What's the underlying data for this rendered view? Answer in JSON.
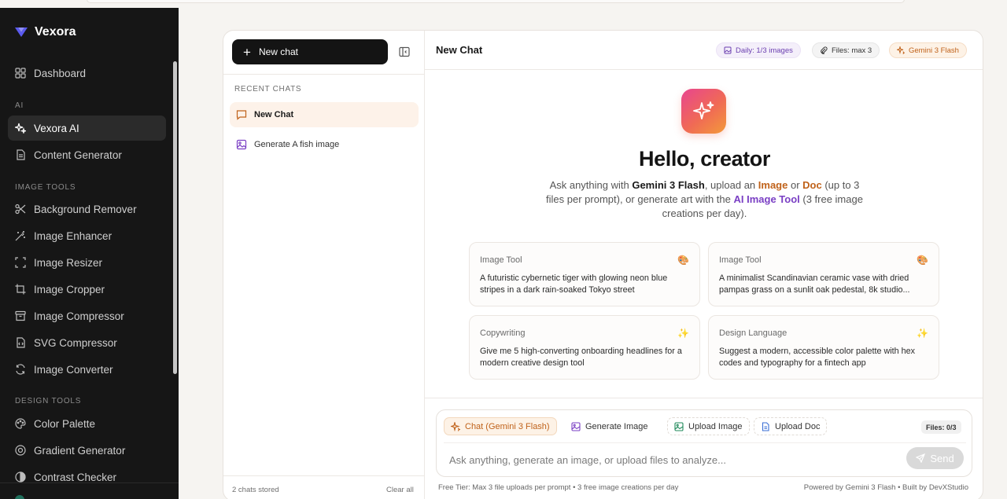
{
  "sidebar": {
    "brand": "Vexora",
    "items": [
      {
        "label": "Dashboard",
        "icon": "grid-icon"
      },
      {
        "label": "Vexora AI",
        "icon": "sparkles-icon"
      },
      {
        "label": "Content Generator",
        "icon": "document-icon"
      },
      {
        "label": "Background Remover",
        "icon": "scissors-icon"
      },
      {
        "label": "Image Enhancer",
        "icon": "wand-icon"
      },
      {
        "label": "Image Resizer",
        "icon": "resize-icon"
      },
      {
        "label": "Image Cropper",
        "icon": "crop-icon"
      },
      {
        "label": "Image Compressor",
        "icon": "archive-icon"
      },
      {
        "label": "SVG Compressor",
        "icon": "file-code-icon"
      },
      {
        "label": "Image Converter",
        "icon": "refresh-icon"
      },
      {
        "label": "Color Palette",
        "icon": "palette-icon"
      },
      {
        "label": "Gradient Generator",
        "icon": "gradient-icon"
      },
      {
        "label": "Contrast Checker",
        "icon": "contrast-icon"
      }
    ],
    "sections": {
      "ai": "AI",
      "image_tools": "IMAGE TOOLS",
      "design_tools": "DESIGN TOOLS"
    }
  },
  "chatlist": {
    "new_chat_label": "New chat",
    "recent_label": "RECENT CHATS",
    "chats": [
      {
        "label": "New Chat",
        "icon": "chat-icon"
      },
      {
        "label": "Generate A fish image",
        "icon": "image-icon"
      }
    ],
    "stored": "2 chats stored",
    "clear_all": "Clear all"
  },
  "header": {
    "title": "New Chat",
    "badges": {
      "daily": "Daily: 1/3 images",
      "files": "Files: max 3",
      "model": "Gemini 3 Flash"
    }
  },
  "hero": {
    "title": "Hello, creator",
    "sub": {
      "p1": "Ask anything with ",
      "model": "Gemini 3 Flash",
      "p2": ", upload an ",
      "image": "Image",
      "p3": " or ",
      "doc": "Doc",
      "p4": " (up to 3 files per prompt), or generate art with the ",
      "tool": "AI Image Tool",
      "p5": " (3 free image creations per day)."
    }
  },
  "suggestions": [
    {
      "category": "Image Tool",
      "emoji": "🎨",
      "text": "A futuristic cybernetic tiger with glowing neon blue stripes in a dark rain-soaked Tokyo street"
    },
    {
      "category": "Image Tool",
      "emoji": "🎨",
      "text": "A minimalist Scandinavian ceramic vase with dried pampas grass on a sunlit oak pedestal, 8k studio..."
    },
    {
      "category": "Copywriting",
      "emoji": "✨",
      "text": "Give me 5 high-converting onboarding headlines for a modern creative design tool"
    },
    {
      "category": "Design Language",
      "emoji": "✨",
      "text": "Suggest a modern, accessible color palette with hex codes and typography for a fintech app"
    }
  ],
  "composer": {
    "modes": {
      "chat": "Chat (Gemini 3 Flash)",
      "generate": "Generate Image",
      "upload_image": "Upload Image",
      "upload_doc": "Upload Doc"
    },
    "files_count": "Files: 0/3",
    "placeholder": "Ask anything, generate an image, or upload files to analyze...",
    "send_label": "Send"
  },
  "footer": {
    "left": "Free Tier: Max 3 file uploads per prompt • 3 free image creations per day",
    "right": "Powered by Gemini 3 Flash • Built by DevXStudio"
  },
  "colors": {
    "accent_orange": "#c0621a",
    "accent_purple": "#7a3fc4",
    "sidebar_bg": "#161616"
  }
}
